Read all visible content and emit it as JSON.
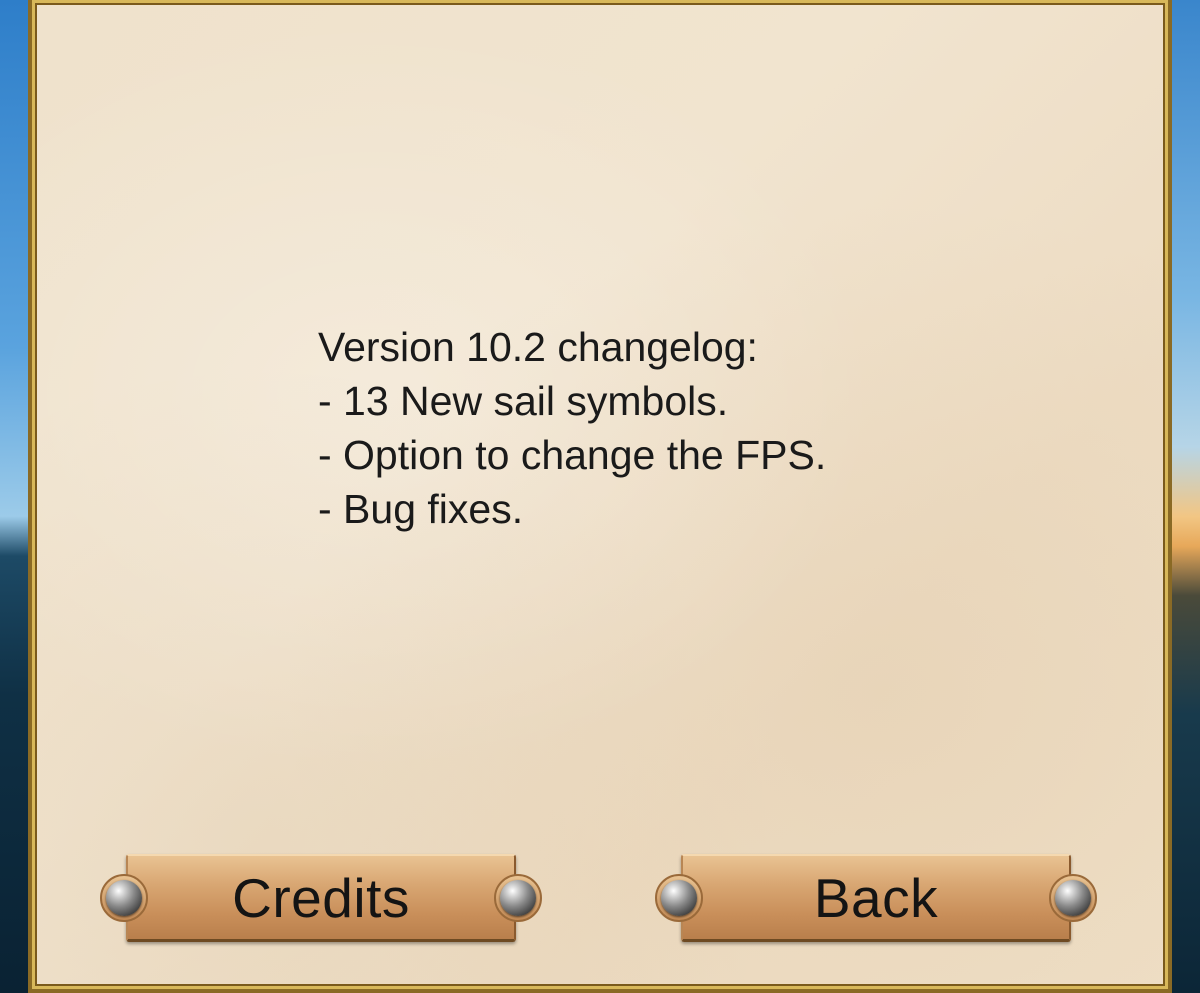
{
  "changelog": {
    "lines": [
      "Version 10.2 changelog:",
      "- 13 New sail symbols.",
      "- Option to change the FPS.",
      "- Bug fixes."
    ]
  },
  "buttons": {
    "credits_label": "Credits",
    "back_label": "Back"
  },
  "colors": {
    "parchment": "#efe2cc",
    "frame_gold": "#8a6a25",
    "button_wood": "#d8a672",
    "text": "#1a1a1a"
  }
}
